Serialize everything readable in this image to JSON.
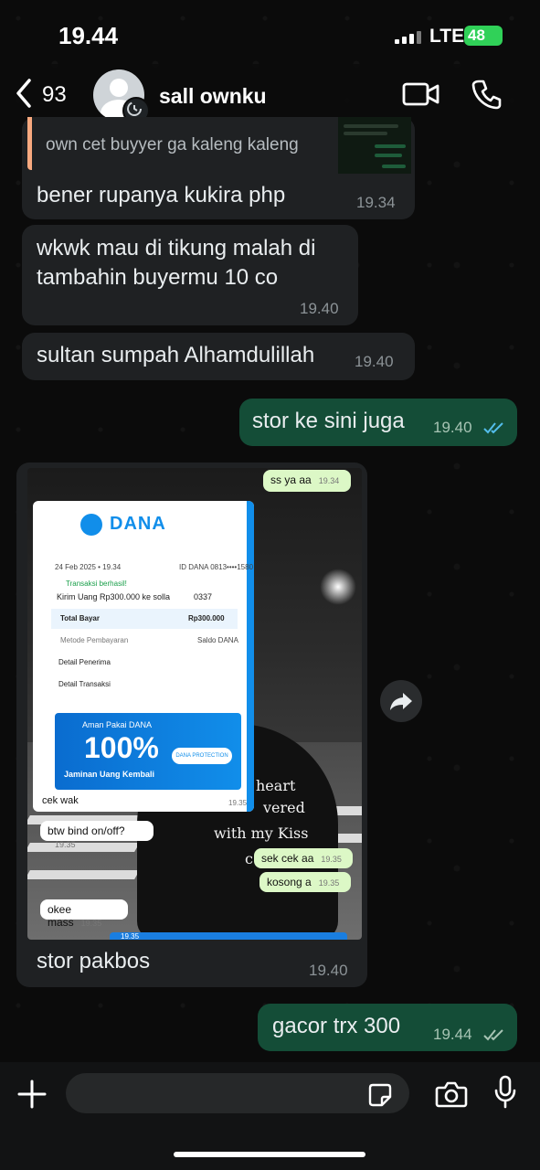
{
  "status_bar": {
    "time": "19.44",
    "network": "LTE",
    "battery": "48"
  },
  "header": {
    "back_count": "93",
    "contact_name": "sall ownku"
  },
  "quoted": {
    "text": "own cet buyyer ga kaleng kaleng"
  },
  "messages": [
    {
      "text": "bener rupanya kukira php",
      "time": "19.34",
      "dir": "in"
    },
    {
      "text": "wkwk mau di tikung malah di",
      "text2": "tambahin buyermu 10 co",
      "time": "19.40",
      "dir": "in"
    },
    {
      "text": "sultan sumpah Alhamdulillah",
      "time": "19.40",
      "dir": "in"
    },
    {
      "text": "stor ke sini juga",
      "time": "19.40",
      "dir": "out"
    },
    {
      "text": "stor pakbos",
      "time": "19.40",
      "dir": "in"
    },
    {
      "text": "gacor trx 300",
      "time": "19.44",
      "dir": "out"
    }
  ],
  "screenshot": {
    "top_bubble": {
      "text": "ss ya aa",
      "time": "19.34"
    },
    "cek_wak": {
      "text": "cek wak",
      "time": "19.35"
    },
    "bind": {
      "text": "btw bind on/off?",
      "time": "19.35"
    },
    "sek_cek": {
      "text": "sek cek aa",
      "time": "19.35"
    },
    "kosong": {
      "text": "kosong a",
      "time": "19.35"
    },
    "okee": {
      "text": "okee mass",
      "time": "19.35"
    },
    "bottom_time": "19.35",
    "hoodie_lines": [
      "heart",
      "vered",
      "with my Kiss",
      "c"
    ],
    "receipt": {
      "brand": "DANA",
      "date": "24 Feb 2025 • 19.34",
      "id": "ID DANA 0813••••1580",
      "status": "Transaksi berhasil!",
      "transfer": "Kirim Uang Rp300.000 ke solla",
      "account": "0337",
      "total_label": "Total Bayar",
      "total_value": "Rp300.000",
      "method_label": "Metode Pembayaran",
      "method_value": "Saldo DANA",
      "detail_recipient": "Detail Penerima",
      "detail_transaction": "Detail Transaksi",
      "banner_top": "Aman Pakai DANA",
      "banner_big": "100%",
      "banner_bottom": "Jaminan Uang Kembali",
      "protection": "DANA PROTECTION"
    }
  },
  "colors": {
    "incoming": "#1f2123",
    "outgoing": "#144d37",
    "read_ticks": "#53bdeb",
    "battery": "#30d158"
  },
  "icons": [
    "back-chevron-icon",
    "video-call-icon",
    "phone-call-icon",
    "forward-icon",
    "plus-icon",
    "sticker-icon",
    "camera-icon",
    "mic-icon",
    "disappearing-timer-icon"
  ]
}
